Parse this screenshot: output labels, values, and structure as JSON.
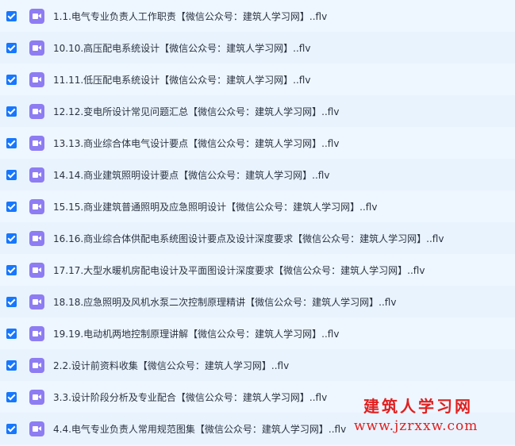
{
  "files": [
    {
      "name": "1.1.电气专业负责人工作职责【微信公众号：建筑人学习网】..flv",
      "checked": true,
      "icon": "video-file-icon"
    },
    {
      "name": "10.10.高压配电系统设计【微信公众号：建筑人学习网】..flv",
      "checked": true,
      "icon": "video-file-icon"
    },
    {
      "name": "11.11.低压配电系统设计【微信公众号：建筑人学习网】..flv",
      "checked": true,
      "icon": "video-file-icon"
    },
    {
      "name": "12.12.变电所设计常见问题汇总【微信公众号：建筑人学习网】..flv",
      "checked": true,
      "icon": "video-file-icon"
    },
    {
      "name": "13.13.商业综合体电气设计要点【微信公众号：建筑人学习网】..flv",
      "checked": true,
      "icon": "video-file-icon"
    },
    {
      "name": "14.14.商业建筑照明设计要点【微信公众号：建筑人学习网】..flv",
      "checked": true,
      "icon": "video-file-icon"
    },
    {
      "name": "15.15.商业建筑普通照明及应急照明设计【微信公众号：建筑人学习网】..flv",
      "checked": true,
      "icon": "video-file-icon"
    },
    {
      "name": "16.16.商业综合体供配电系统图设计要点及设计深度要求【微信公众号：建筑人学习网】..flv",
      "checked": true,
      "icon": "video-file-icon"
    },
    {
      "name": "17.17.大型水暖机房配电设计及平面图设计深度要求【微信公众号：建筑人学习网】..flv",
      "checked": true,
      "icon": "video-file-icon"
    },
    {
      "name": "18.18.应急照明及风机水泵二次控制原理精讲【微信公众号：建筑人学习网】..flv",
      "checked": true,
      "icon": "video-file-icon"
    },
    {
      "name": "19.19.电动机两地控制原理讲解【微信公众号：建筑人学习网】..flv",
      "checked": true,
      "icon": "video-file-icon"
    },
    {
      "name": "2.2.设计前资料收集【微信公众号：建筑人学习网】..flv",
      "checked": true,
      "icon": "video-file-icon"
    },
    {
      "name": "3.3.设计阶段分析及专业配合【微信公众号：建筑人学习网】..flv",
      "checked": true,
      "icon": "video-file-icon"
    },
    {
      "name": "4.4.电气专业负责人常用规范图集【微信公众号：建筑人学习网】..flv",
      "checked": true,
      "icon": "video-file-icon"
    }
  ],
  "watermark": {
    "title": "建筑人学习网",
    "url": "www.jzrxxw.com",
    "color": "#e02020"
  },
  "colors": {
    "checkbox": "#1677ff",
    "video_icon": "#8e7cf3",
    "background": "#eef6ff"
  }
}
